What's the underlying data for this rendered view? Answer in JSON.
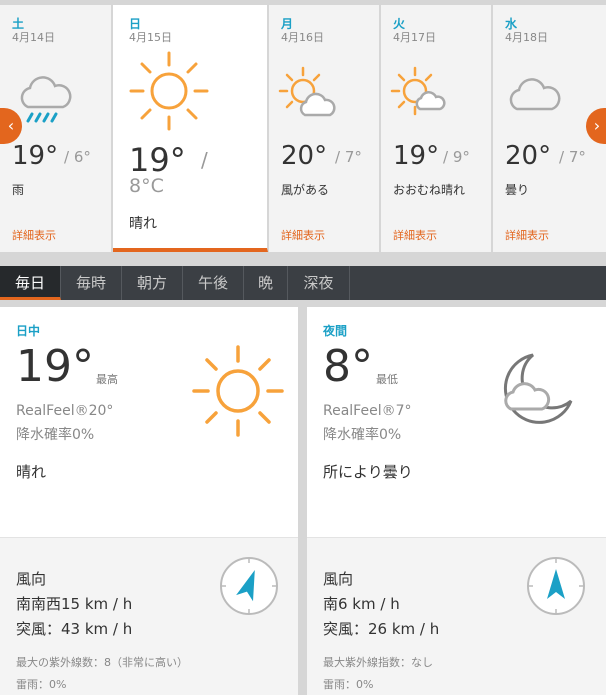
{
  "days": [
    {
      "dow": "土",
      "date": "4月14日",
      "hi": "19°",
      "lo": "/ 6°",
      "phrase": "雨",
      "details": "詳細表示",
      "icon": "rain-cloud-icon"
    },
    {
      "dow": "日",
      "date": "4月15日",
      "hi": "19°",
      "lo": "/",
      "lo_value": "8°C",
      "phrase": "晴れ",
      "details": "",
      "icon": "sun-icon",
      "active": true
    },
    {
      "dow": "月",
      "date": "4月16日",
      "hi": "20°",
      "lo": "/ 7°",
      "phrase": "風がある",
      "details": "詳細表示",
      "icon": "partly-sunny-icon"
    },
    {
      "dow": "火",
      "date": "4月17日",
      "hi": "19°",
      "lo": "/ 9°",
      "phrase": "おおむね晴れ",
      "details": "詳細表示",
      "icon": "partly-sunny-icon"
    },
    {
      "dow": "水",
      "date": "4月18日",
      "hi": "20°",
      "lo": "/ 7°",
      "phrase": "曇り",
      "details": "詳細表示",
      "icon": "cloud-icon"
    }
  ],
  "nav": {
    "prev": "‹",
    "next": "›"
  },
  "tabs": [
    "毎日",
    "毎時",
    "朝方",
    "午後",
    "晩",
    "深夜"
  ],
  "day_panel": {
    "label": "日中",
    "temp": "19°",
    "hilo": "最高",
    "realfeel": "RealFeel®20°",
    "precip": "降水確率0%",
    "condition": "晴れ",
    "wind_heading": "風向",
    "wind": "南南西15 km / h",
    "gust": "突風：43 km / h",
    "uv": "最大の紫外線数：8（非常に高い）",
    "storm": "雷雨：0%"
  },
  "night_panel": {
    "label": "夜間",
    "temp": "8°",
    "hilo": "最低",
    "realfeel": "RealFeel®7°",
    "precip": "降水確率0%",
    "condition": "所により曇り",
    "wind_heading": "風向",
    "wind": "南6 km / h",
    "gust": "突風：26 km / h",
    "uv": "最大紫外線指数：なし",
    "storm": "雷雨：0%"
  },
  "colors": {
    "accent": "#e3661e",
    "link_blue": "#1ba0c6",
    "sun": "#f7a23b",
    "tab_bar": "#3b3f44"
  }
}
